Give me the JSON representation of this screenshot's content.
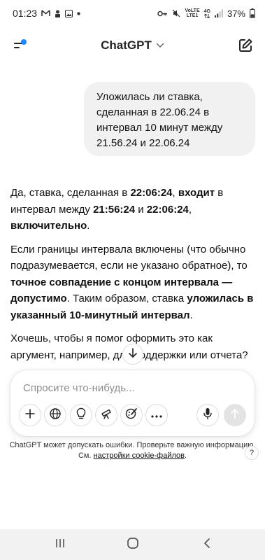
{
  "status_bar": {
    "time": "01:23",
    "battery": "37%",
    "net_top": "VoLTE",
    "net_bottom": "LTE1",
    "signal_label": "4G"
  },
  "header": {
    "title": "ChatGPT"
  },
  "user_message": {
    "text": "Уложилась ли ставка, сделанная в 22.06.24 в интервал 10 минут между 21.56.24 и 22.06.24"
  },
  "assistant_message": {
    "p1": {
      "t1": "Да, ставка, сделанная в ",
      "b1": "22:06:24",
      "t2": ", ",
      "b2": "входит",
      "t3": " в интервал между ",
      "b3": "21:56:24",
      "t4": " и ",
      "b4": "22:06:24",
      "t5": ", ",
      "b5": "включительно",
      "t6": "."
    },
    "p2": {
      "t1": "Если границы интервала включены (что обычно подразумевается, если не указано обратное), то ",
      "b1": "точное совпадение с концом интервала — допустимо",
      "t2": ". Таким образом, ставка ",
      "b2": "уложилась в указанный 10-минутный интервал",
      "t3": "."
    },
    "p3": {
      "text": "Хочешь, чтобы я помог оформить это как аргумент, например, для поддержки или отчета?"
    }
  },
  "composer": {
    "placeholder": "Спросите что-нибудь..."
  },
  "disclaimer": {
    "line1": "ChatGPT может допускать ошибки. Проверьте важную информацию.",
    "prefix": "См. ",
    "link": "настройки cookie-файлов",
    "suffix": "."
  },
  "help_label": "?",
  "icons": [
    "menu-icon",
    "edit-icon",
    "plus-icon",
    "globe-icon",
    "lightbulb-icon",
    "telescope-icon",
    "paintbrush-icon",
    "more-icon",
    "mic-icon",
    "arrow-up-icon",
    "arrow-down-icon",
    "recents-icon",
    "home-icon",
    "back-icon"
  ],
  "colors": {
    "accent_dot": "#1e88ff",
    "user_bubble": "#f1f1f1",
    "send_button": "#e3e3e3"
  }
}
